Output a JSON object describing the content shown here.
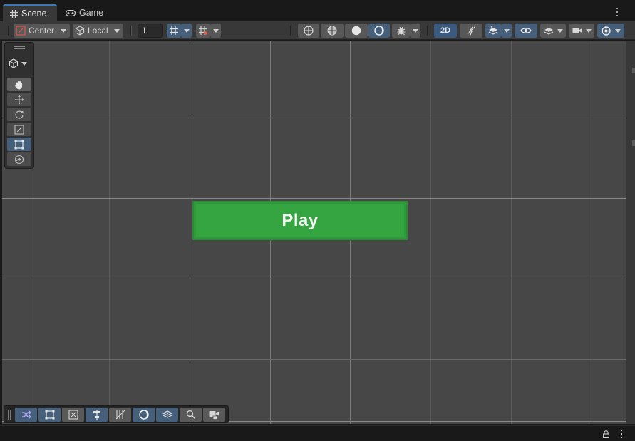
{
  "tabs": [
    {
      "label": "Scene",
      "icon": "grid-icon",
      "active": true
    },
    {
      "label": "Game",
      "icon": "gamepad-icon",
      "active": false
    }
  ],
  "toolbar": {
    "pivot_mode": "Center",
    "pivot_rotation": "Local",
    "grid_size": "1",
    "mode_2d_label": "2D"
  },
  "scene": {
    "play_button_label": "Play",
    "play_button_color": "#35a541",
    "background_color": "#474747"
  },
  "colors": {
    "accent": "#3a79bb",
    "active_tool": "#46607c"
  }
}
